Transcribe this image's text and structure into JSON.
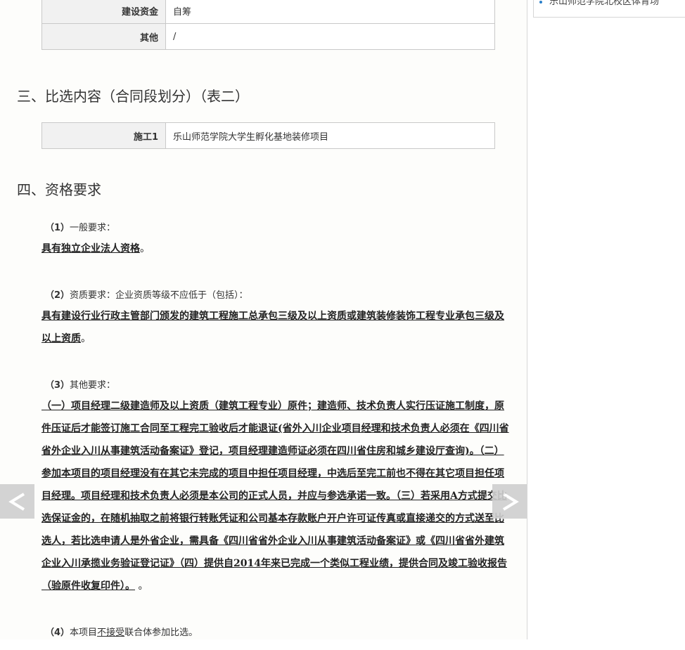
{
  "sidebar": {
    "item_text": "乐山师范学院北校区体育场"
  },
  "table1": {
    "rows": [
      {
        "key": "建设资金",
        "value": "自筹"
      },
      {
        "key": "其他",
        "value": "/"
      }
    ]
  },
  "section3": {
    "title": "三、比选内容（合同段划分）（表二）",
    "rows": [
      {
        "key": "施工1",
        "value": "乐山师范学院大学生孵化基地装修项目"
      }
    ]
  },
  "section4": {
    "title": "四、资格要求",
    "req1": {
      "num": "（1）",
      "label": "一般要求：",
      "text": "具有独立企业法人资格",
      "tail": "。"
    },
    "req2": {
      "num": "（2）",
      "label": "资质要求：企业资质等级不应低于（包括）：",
      "text": "具有建设行业行政主管部门颁发的建筑工程施工总承包三级及以上资质或建筑装修装饰工程专业承包三级及以上资质",
      "tail": "。"
    },
    "req3": {
      "num": "（3）",
      "label": "其他要求：",
      "text": "（一）项目经理二级建造师及以上资质（建筑工程专业）原件；建造师、技术负责人实行压证施工制度，原件压证后才能签订施工合同至工程完工验收后才能退证(省外入川企业项目经理和技术负责人必须在《四川省省外企业入川从事建筑活动备案证》登记，项目经理建造师证必须在四川省住房和城乡建设厅查询)。（二）参加本项目的项目经理没有在其它未完成的项目中担任项目经理，中选后至完工前也不得在其它项目担任项目经理。项目经理和技术负责人必须是本公司的正式人员，并应与参选承诺一致。（三）若采用A方式提交比选保证金的，在随机抽取之前将银行转账凭证和公司基本存款账户开户许可证传真或直接递交的方式送至比选人，若比选申请人是外省企业，需具备《四川省省外企业入川从事建筑活动备案证》或《四川省省外建筑企业入川承揽业务验证登记证》（四）提供自2014年来已完成一个类似工程业绩，提供合同及竣工验收报告（验原件收复印件）。",
      "tail": " 。"
    },
    "req4": {
      "num": "（4）",
      "prefix": "本项目",
      "emph": "不接受",
      "suffix": "联合体参加比选。"
    }
  },
  "nav": {
    "prev_symbol": "<",
    "next_symbol": ">"
  }
}
